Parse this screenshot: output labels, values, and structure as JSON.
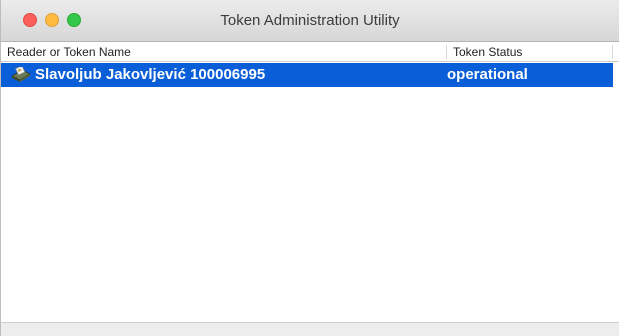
{
  "window": {
    "title": "Token Administration Utility"
  },
  "table": {
    "columns": [
      "Reader or Token Name",
      "Token Status"
    ],
    "rows": [
      {
        "name": "Slavoljub Jakovljević 100006995",
        "status": "operational",
        "icon": "smartcard-reader-icon",
        "selected": true
      }
    ]
  },
  "colors": {
    "selection": "#0a5fd9",
    "close": "#fc605c",
    "minimize": "#fdbc40",
    "maximize": "#34c84a"
  }
}
